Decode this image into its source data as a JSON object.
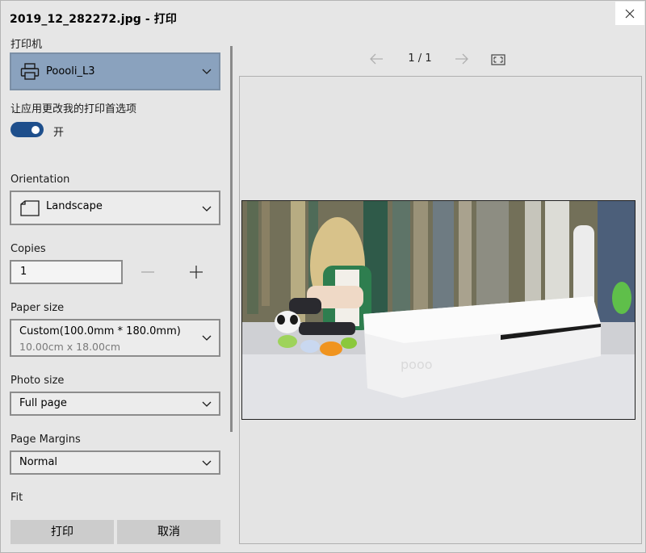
{
  "window": {
    "title": "2019_12_282272.jpg - 打印"
  },
  "printer": {
    "label": "打印机",
    "selected": "Poooli_L3"
  },
  "app_prefs": {
    "label": "让应用更改我的打印首选项",
    "toggle_on": true,
    "toggle_state_text": "开"
  },
  "orientation": {
    "label": "Orientation",
    "selected": "Landscape"
  },
  "copies": {
    "label": "Copies",
    "value": "1"
  },
  "paper_size": {
    "label": "Paper size",
    "selected": "Custom(100.0mm * 180.0mm)",
    "sub": "10.00cm x 18.00cm"
  },
  "photo_size": {
    "label": "Photo size",
    "selected": "Full page"
  },
  "page_margins": {
    "label": "Page Margins",
    "selected": "Normal"
  },
  "fit": {
    "label": "Fit"
  },
  "buttons": {
    "print": "打印",
    "cancel": "取消"
  },
  "preview": {
    "page_indicator": "1 / 1"
  },
  "colors": {
    "background": "#e6e6e6",
    "printer_select_bg": "#8aa2be",
    "toggle_on": "#1e4f8c",
    "button_bg": "#cccccc"
  }
}
